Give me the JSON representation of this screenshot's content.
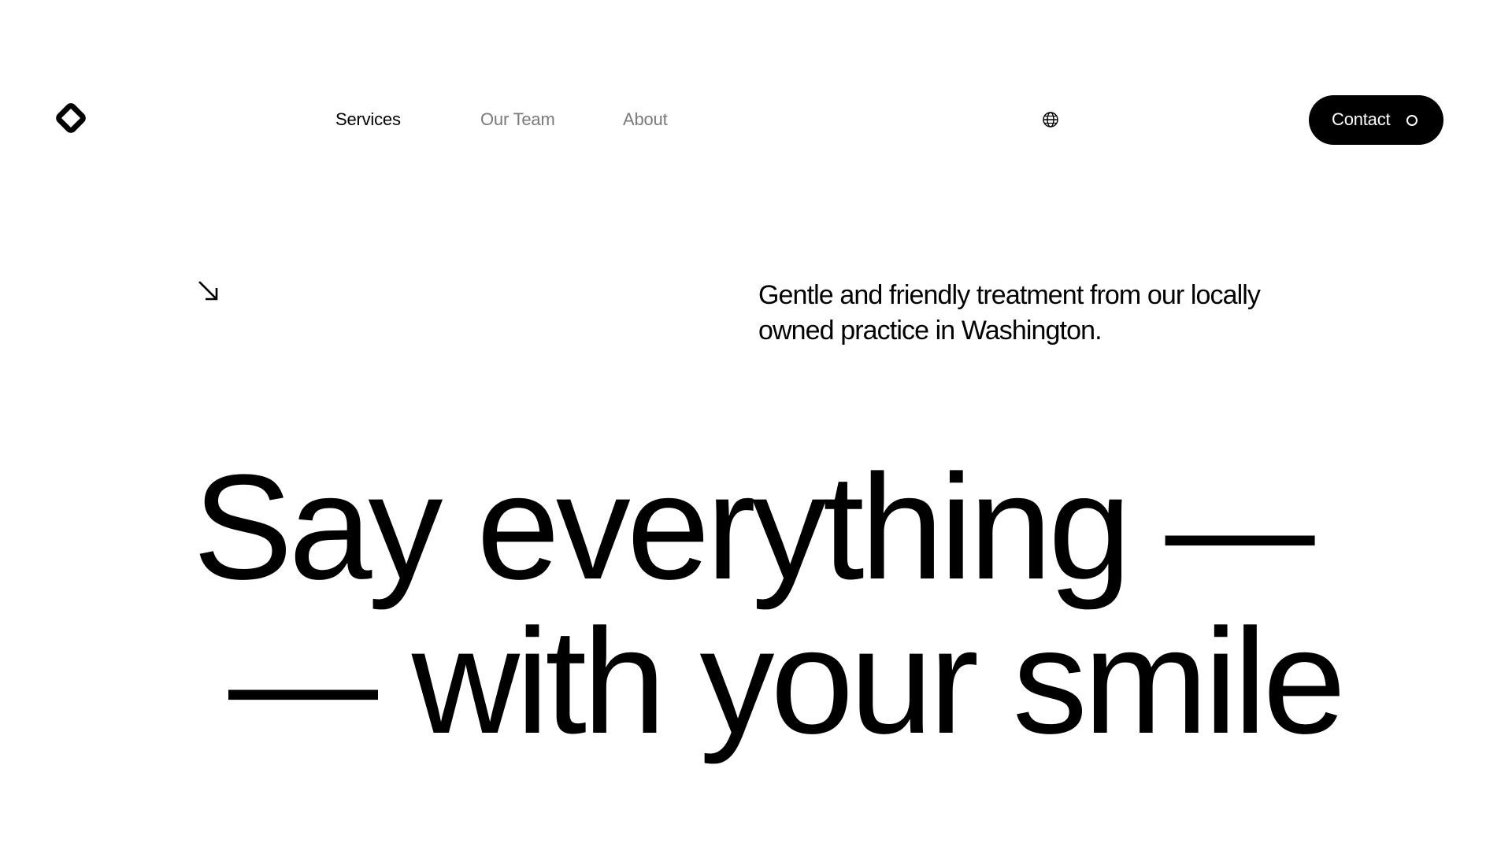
{
  "header": {
    "logo_icon": "diamond-logo-icon",
    "nav": {
      "services": "Services",
      "our_team": "Our Team",
      "about": "About"
    },
    "language_icon": "globe-icon",
    "contact": {
      "label": "Contact",
      "icon": "circle-icon"
    }
  },
  "hero": {
    "arrow_icon": "arrow-down-right-icon",
    "intro": "Gentle and friendly treatment from our locally owned practice in Washington.",
    "headline": {
      "line1": "Say everything —",
      "line2": "— with your smile"
    }
  },
  "colors": {
    "text": "#000000",
    "muted_nav": "#7a7a7a",
    "background": "#ffffff",
    "button_bg": "#000000",
    "button_text": "#ffffff"
  }
}
